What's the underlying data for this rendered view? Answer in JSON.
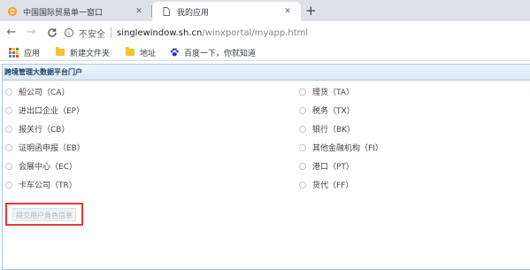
{
  "browser": {
    "tabs": [
      {
        "title": "中国国际贸易单一窗口",
        "icon": "ie-logo-icon",
        "close": "✕"
      },
      {
        "title": "我的应用",
        "icon": "document-icon",
        "close": "✕"
      }
    ],
    "new_tab": "+",
    "nav": {
      "back": "←",
      "forward": "→",
      "reload": "C",
      "home": "⌂"
    },
    "address": {
      "security_label": "不安全",
      "host": "singlewindow.sh.cn",
      "path": "/winxportal/myapp.html"
    },
    "bookmarks": [
      {
        "label": "应用",
        "icon": "apps-grid-icon"
      },
      {
        "label": "新建文件夹",
        "icon": "folder-icon"
      },
      {
        "label": "地址",
        "icon": "folder-icon"
      },
      {
        "label": "百度一下，你就知道",
        "icon": "baidu-paw-icon"
      }
    ]
  },
  "panel": {
    "title": "跨境管理大数据平台门户",
    "left_options": [
      "船公司（CA）",
      "进出口企业（EP）",
      "报关行（CB）",
      "证明函申报（EB）",
      "会展中心（EC）",
      "卡车公司（TR）"
    ],
    "right_options": [
      "理货（TA）",
      "税务（TX）",
      "银行（BK）",
      "其他金融机构（FI）",
      "港口（PT）",
      "货代（FF）"
    ],
    "submit_label": "提交用户角色信息"
  },
  "colors": {
    "panel_border": "#a7c8e7",
    "panel_title": "#1c3f63",
    "highlight": "#e53935"
  }
}
